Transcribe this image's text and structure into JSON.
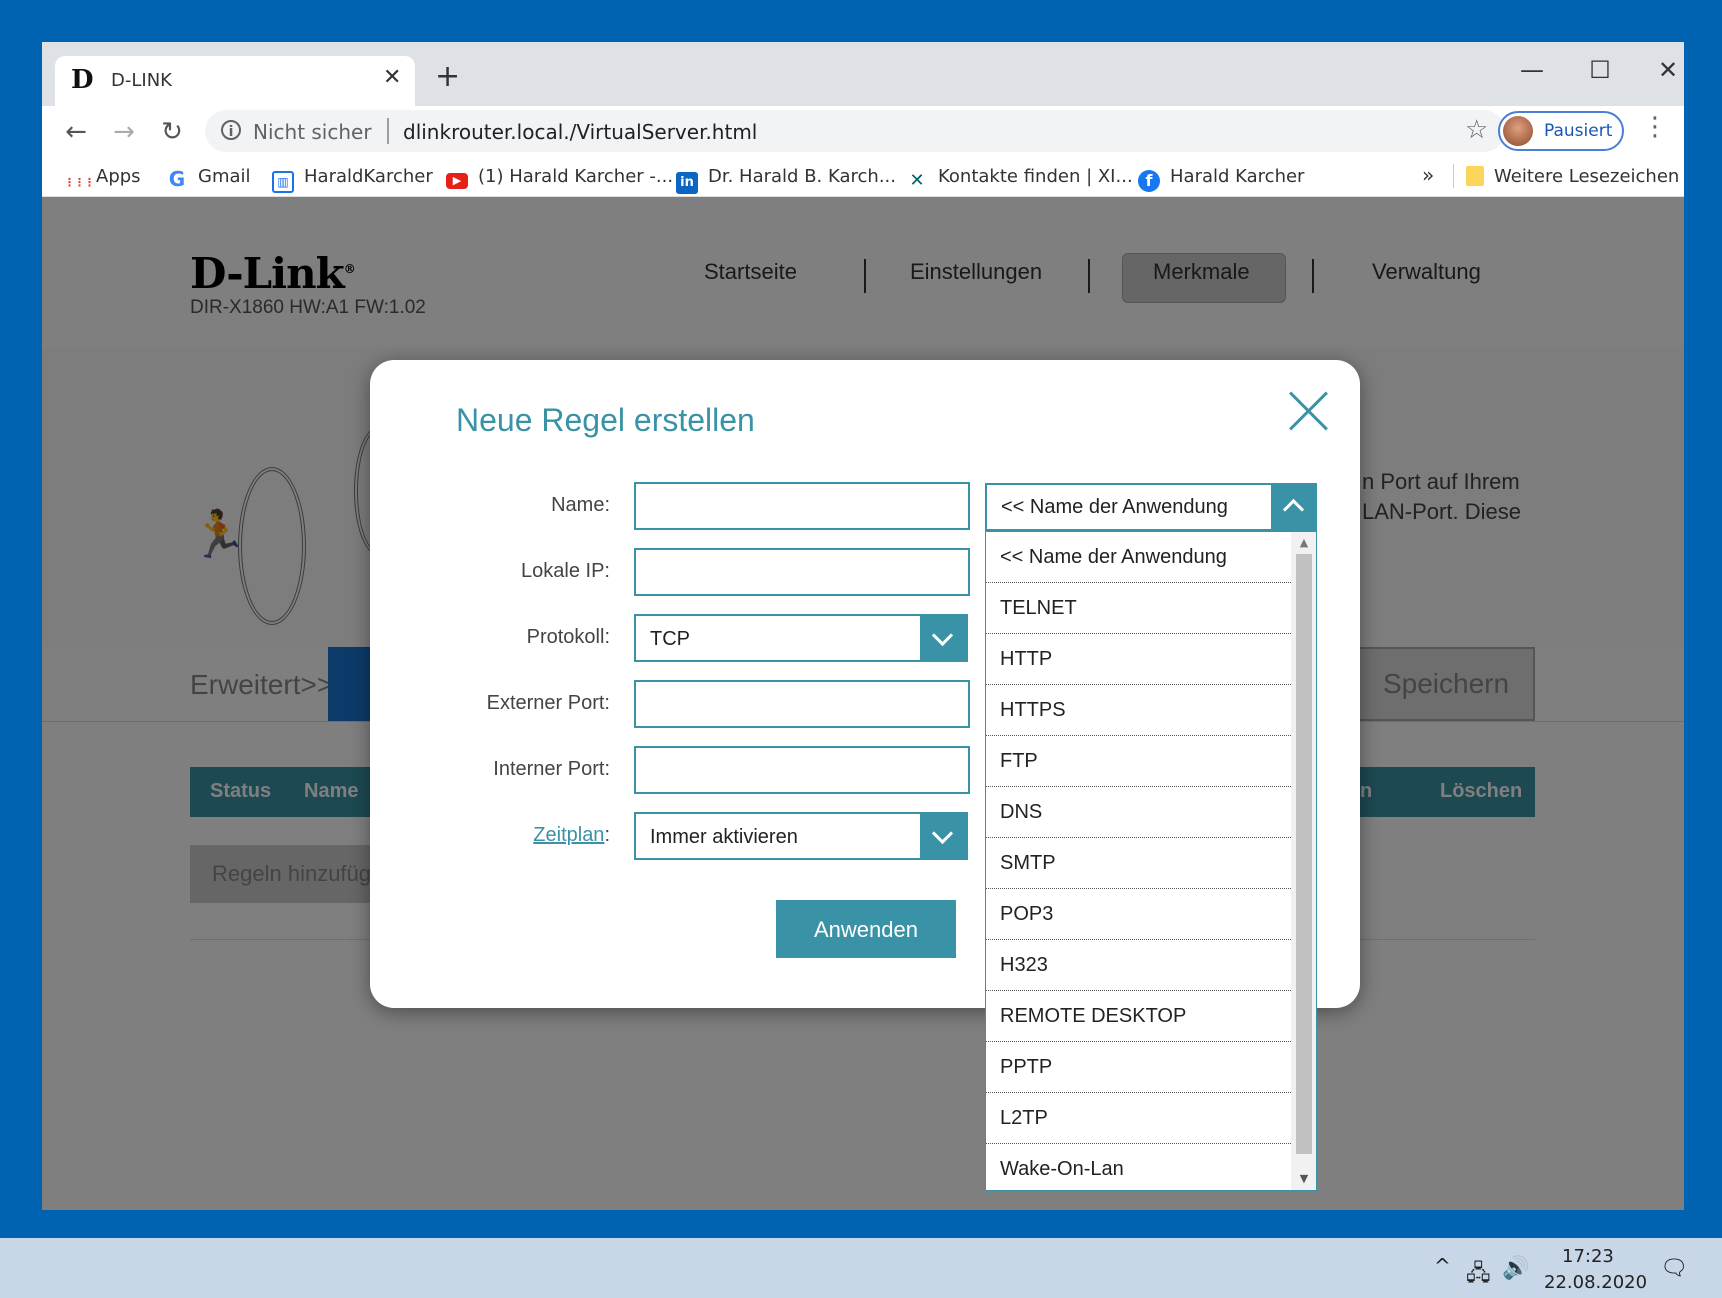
{
  "browser": {
    "tab_title": "D-LINK",
    "tab_favicon": "D",
    "tab_close": "✕",
    "new_tab": "+",
    "window_controls": {
      "minimize": "—",
      "maximize": "☐",
      "close": "✕"
    },
    "nav": {
      "back": "←",
      "forward": "→",
      "reload": "↻"
    },
    "address": {
      "security_icon": "ⓘ",
      "security_label": "Nicht sicher",
      "url": "dlinkrouter.local./VirtualServer.html",
      "star": "☆"
    },
    "profile_label": "Pausiert",
    "menu": "⋮",
    "bookmarks": [
      {
        "label": "Apps",
        "icon": "apps-grid-icon",
        "glyph": "⋮⋮⋮",
        "color": "#e53935"
      },
      {
        "label": "Gmail",
        "icon": "google-icon",
        "glyph": "G",
        "color": "#4285f4"
      },
      {
        "label": "HaraldKarcher",
        "icon": "page-icon",
        "glyph": "▥",
        "color": "#1a73e8"
      },
      {
        "label": "(1) Harald Karcher -...",
        "icon": "youtube-icon",
        "glyph": "▶",
        "color": "#e62117"
      },
      {
        "label": "Dr. Harald B. Karch...",
        "icon": "linkedin-icon",
        "glyph": "in",
        "color": "#0a66c2"
      },
      {
        "label": "Kontakte finden | XI...",
        "icon": "xing-icon",
        "glyph": "✕",
        "color": "#006567"
      },
      {
        "label": "Harald Karcher",
        "icon": "facebook-icon",
        "glyph": "f",
        "color": "#1877f2"
      }
    ],
    "bookmarks_more": "»",
    "other_bookmarks": "Weitere Lesezeichen"
  },
  "router": {
    "logo": "D-Link",
    "logo_mark": "®",
    "model": "DIR-X1860 HW:A1 FW:1.02",
    "nav": [
      "Startseite",
      "Einstellungen",
      "Merkmale",
      "Verwaltung"
    ],
    "nav_active": "Merkmale",
    "hero_text_line1": "n Port auf Ihrem",
    "hero_text_line2": "LAN-Port. Diese",
    "breadcrumb": "Erweitert>>Virt",
    "save": "Speichern",
    "table_headers": [
      "Status",
      "Name"
    ],
    "table_header_right": "Löschen",
    "table_header_right_partial": "n",
    "add_rule": "Regeln hinzufüg"
  },
  "modal": {
    "title": "Neue Regel erstellen",
    "fields": {
      "name": {
        "label": "Name:",
        "value": ""
      },
      "local_ip": {
        "label": "Lokale IP:",
        "value": ""
      },
      "protocol": {
        "label": "Protokoll:",
        "value": "TCP"
      },
      "external_port": {
        "label": "Externer Port:",
        "value": ""
      },
      "internal_port": {
        "label": "Interner Port:",
        "value": ""
      },
      "schedule": {
        "label_link": "Zeitplan",
        "label_suffix": ":",
        "value": "Immer aktivieren"
      }
    },
    "apply": "Anwenden",
    "app_select": {
      "value": "<< Name der Anwendung",
      "options": [
        "<< Name der Anwendung",
        "TELNET",
        "HTTP",
        "HTTPS",
        "FTP",
        "DNS",
        "SMTP",
        "POP3",
        "H323",
        "REMOTE DESKTOP",
        "PPTP",
        "L2TP",
        "Wake-On-Lan"
      ]
    }
  },
  "taskbar": {
    "tray_up": "^",
    "network_icon": "🖧",
    "volume_icon": "🔊",
    "time": "17:23",
    "date": "22.08.2020",
    "notifications_icon": "🗨"
  },
  "colors": {
    "accent": "#3a92a6",
    "desktop": "#0063b1",
    "taskbar": "#c7d7e8"
  }
}
